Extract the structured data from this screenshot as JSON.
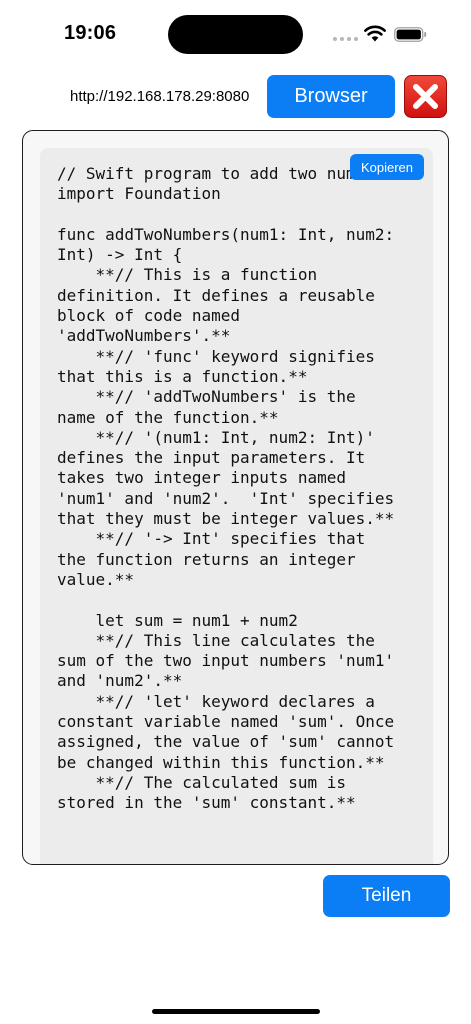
{
  "status_bar": {
    "time": "19:06",
    "icons": [
      "signal-dots-icon",
      "wifi-icon",
      "battery-icon"
    ]
  },
  "header": {
    "url": "http://192.168.178.29:8080",
    "browser_label": "Browser",
    "close_icon": "red-x-close-icon"
  },
  "code": {
    "copy_label": "Kopieren",
    "text": "// Swift program to add two numbers\nimport Foundation\n\nfunc addTwoNumbers(num1: Int, num2: Int) -> Int {\n    **// This is a function definition. It defines a reusable block of code named 'addTwoNumbers'.**\n    **// 'func' keyword signifies that this is a function.**\n    **// 'addTwoNumbers' is the name of the function.**\n    **// '(num1: Int, num2: Int)' defines the input parameters. It takes two integer inputs named 'num1' and 'num2'.  'Int' specifies that they must be integer values.**\n    **// '-> Int' specifies that the function returns an integer value.**\n\n    let sum = num1 + num2\n    **// This line calculates the sum of the two input numbers 'num1' and 'num2'.**\n    **// 'let' keyword declares a constant variable named 'sum'. Once assigned, the value of 'sum' cannot be changed within this function.**\n    **// The calculated sum is stored in the 'sum' constant.**"
  },
  "footer": {
    "share_label": "Teilen"
  },
  "colors": {
    "accent": "#0b7ef5",
    "close_red": "#e5201d",
    "code_background": "#ececec"
  }
}
